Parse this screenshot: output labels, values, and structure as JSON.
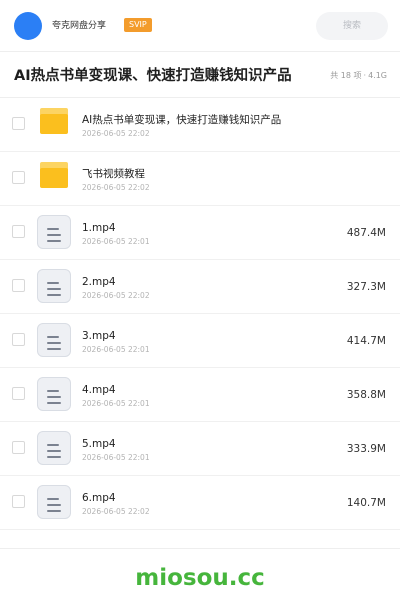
{
  "header": {
    "share_name": "夸克网盘分享",
    "badge": "SVIP",
    "search_placeholder": "搜索"
  },
  "titlebar": {
    "title": "AI热点书单变现课、快速打造赚钱知识产品",
    "item_count": "共 18 项",
    "separator": "·",
    "total_size": "4.1G"
  },
  "files": [
    {
      "type": "folder",
      "name": "AI热点书单变现课，快速打造赚钱知识产品",
      "date": "2026-06-05 22:02",
      "size": ""
    },
    {
      "type": "folder",
      "name": "飞书视频教程",
      "date": "2026-06-05 22:02",
      "size": ""
    },
    {
      "type": "file",
      "name": "1.mp4",
      "date": "2026-06-05 22:01",
      "size": "487.4M"
    },
    {
      "type": "file",
      "name": "2.mp4",
      "date": "2026-06-05 22:02",
      "size": "327.3M"
    },
    {
      "type": "file",
      "name": "3.mp4",
      "date": "2026-06-05 22:01",
      "size": "414.7M"
    },
    {
      "type": "file",
      "name": "4.mp4",
      "date": "2026-06-05 22:01",
      "size": "358.8M"
    },
    {
      "type": "file",
      "name": "5.mp4",
      "date": "2026-06-05 22:01",
      "size": "333.9M"
    },
    {
      "type": "file",
      "name": "6.mp4",
      "date": "2026-06-05 22:02",
      "size": "140.7M"
    }
  ],
  "watermark": "miosou.cc",
  "colors": {
    "accent_blue": "#2b7ff5",
    "svip_orange": "#f39c2c",
    "folder_yellow": "#fbbf1e",
    "watermark_green": "#46b53c"
  }
}
